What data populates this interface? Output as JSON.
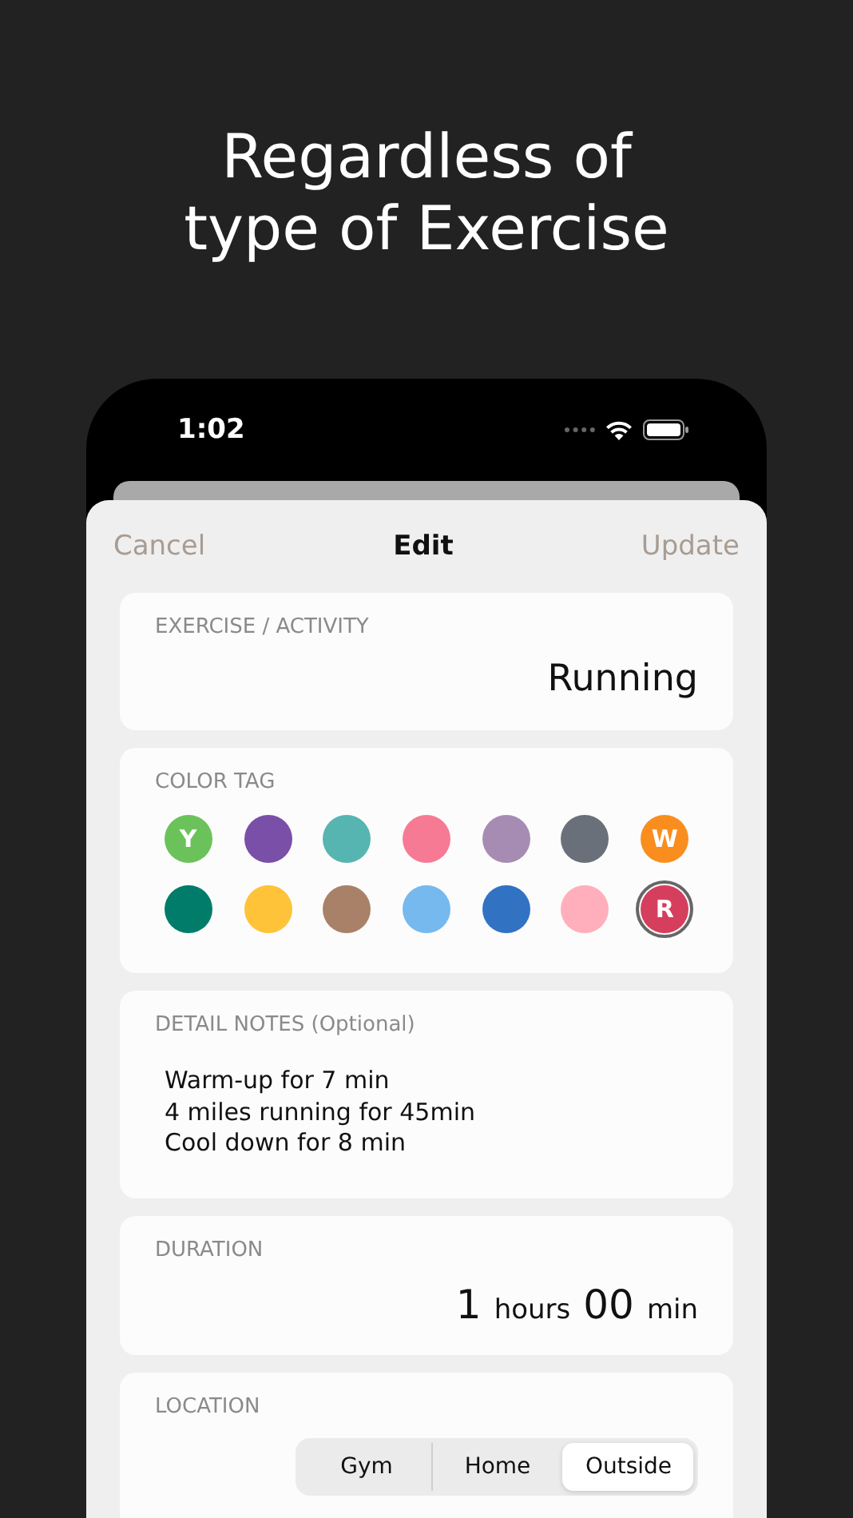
{
  "headline": [
    "Regardless of",
    "type of Exercise"
  ],
  "status_bar": {
    "time": "1:02"
  },
  "nav": {
    "cancel": "Cancel",
    "title": "Edit",
    "update": "Update"
  },
  "activity": {
    "label": "EXERCISE / ACTIVITY",
    "value": "Running"
  },
  "color_tag": {
    "label": "COLOR TAG",
    "colors": [
      {
        "color": "#6cc25a",
        "letter": "Y",
        "selected": false
      },
      {
        "color": "#7a4fa8",
        "selected": false
      },
      {
        "color": "#56b5b0",
        "selected": false
      },
      {
        "color": "#f77a94",
        "selected": false
      },
      {
        "color": "#a68cb2",
        "selected": false
      },
      {
        "color": "#6a7079",
        "selected": false
      },
      {
        "color": "#f98e1f",
        "letter": "W",
        "selected": false
      },
      {
        "color": "#017c6b",
        "selected": false
      },
      {
        "color": "#fec338",
        "selected": false
      },
      {
        "color": "#a88168",
        "selected": false
      },
      {
        "color": "#75b9ee",
        "selected": false
      },
      {
        "color": "#3272c3",
        "selected": false
      },
      {
        "color": "#feafbb",
        "selected": false
      },
      {
        "color": "#d63e5e",
        "letter": "R",
        "selected": true
      }
    ]
  },
  "notes": {
    "label": "DETAIL NOTES (Optional)",
    "lines": [
      "Warm-up for 7 min",
      "4 miles running for 45min",
      "Cool down for 8 min"
    ]
  },
  "duration": {
    "label": "DURATION",
    "hours": "1",
    "hours_unit": "hours",
    "minutes": "00",
    "minutes_unit": "min"
  },
  "location": {
    "label": "LOCATION",
    "options": [
      {
        "label": "Gym",
        "selected": false
      },
      {
        "label": "Home",
        "selected": false
      },
      {
        "label": "Outside",
        "selected": true
      }
    ]
  }
}
